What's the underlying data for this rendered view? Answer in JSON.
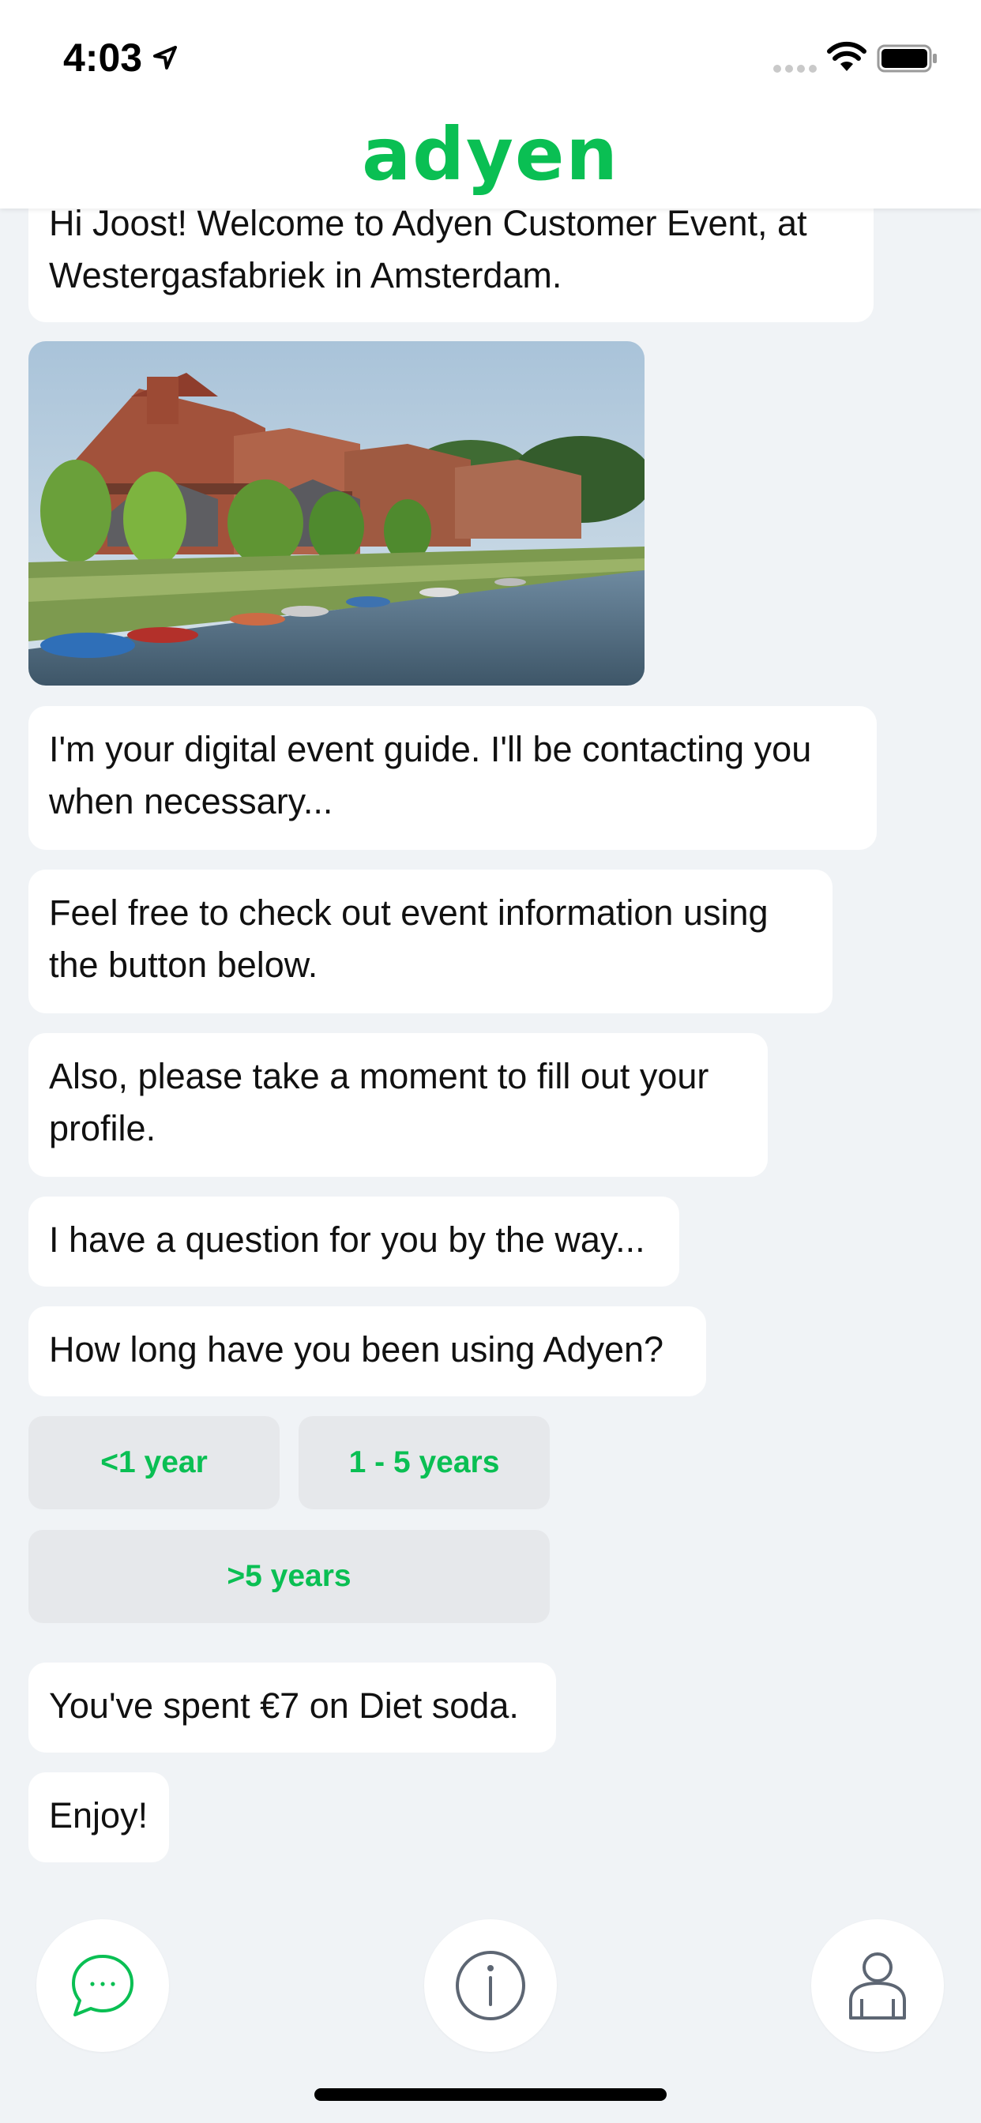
{
  "status_bar": {
    "time": "4:03"
  },
  "header": {
    "brand": "adyen"
  },
  "chat": {
    "messages": [
      "Hi Joost! Welcome to Adyen Customer Event, at Westergasfabriek in Amsterdam.",
      "I'm your digital event guide. I'll be contacting you when necessary...",
      "Feel free to check out event information using the button below.",
      "Also, please take a moment to fill out your profile.",
      "I have a question for you by the way...",
      "How long have you been using Adyen?",
      "You've spent €7 on Diet soda.",
      "Enjoy!"
    ],
    "quick_replies": [
      "<1 year",
      "1 - 5 years",
      ">5 years"
    ]
  },
  "tab_bar": {
    "items": [
      {
        "icon": "chat-bubble-icon",
        "active": true
      },
      {
        "icon": "info-icon",
        "active": false
      },
      {
        "icon": "profile-icon",
        "active": false
      }
    ]
  },
  "colors": {
    "brand": "#0abf53",
    "background": "#f0f3f6",
    "bubble": "#ffffff",
    "reply_button": "#e6e8eb",
    "icon_gray": "#5d6673"
  }
}
